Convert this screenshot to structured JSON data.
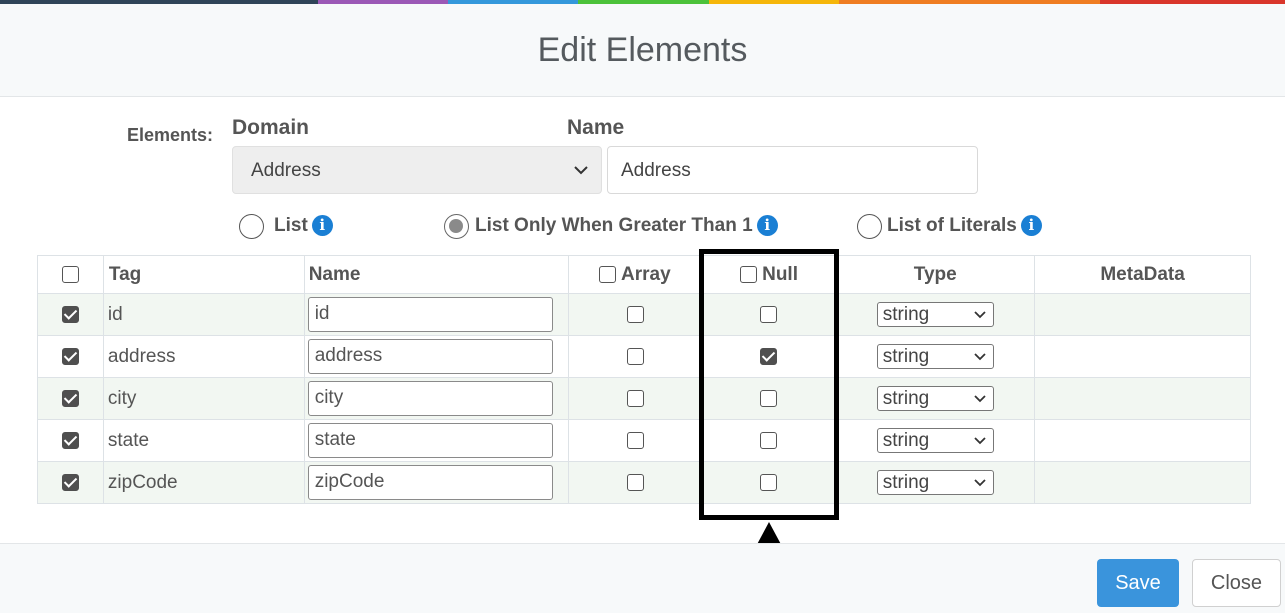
{
  "accent_colors": [
    "#2f4458",
    "#9b59b6",
    "#3498db",
    "#4cc23a",
    "#f5b60a",
    "#ef7d22",
    "#d9362b"
  ],
  "dialog": {
    "title": "Edit Elements"
  },
  "form": {
    "elements_label": "Elements:",
    "domain_label": "Domain",
    "domain_value": "Address",
    "name_label": "Name",
    "name_value": "Address"
  },
  "list_options": [
    {
      "label": "List",
      "selected": false,
      "icon": "info-icon"
    },
    {
      "label": "List Only When Greater Than 1",
      "selected": true,
      "icon": "info-icon"
    },
    {
      "label": "List of Literals",
      "selected": false,
      "icon": "info-icon"
    }
  ],
  "table": {
    "headers": {
      "tag": "Tag",
      "name": "Name",
      "array": "Array",
      "null": "Null",
      "type": "Type",
      "metadata": "MetaData"
    },
    "header_checks": {
      "select_all": false,
      "array": false,
      "null": false
    },
    "rows": [
      {
        "selected": true,
        "tag": "id",
        "name": "id",
        "array": false,
        "null": false,
        "type": "string",
        "metadata": ""
      },
      {
        "selected": true,
        "tag": "address",
        "name": "address",
        "array": false,
        "null": true,
        "type": "string",
        "metadata": ""
      },
      {
        "selected": true,
        "tag": "city",
        "name": "city",
        "array": false,
        "null": false,
        "type": "string",
        "metadata": ""
      },
      {
        "selected": true,
        "tag": "state",
        "name": "state",
        "array": false,
        "null": false,
        "type": "string",
        "metadata": ""
      },
      {
        "selected": true,
        "tag": "zipCode",
        "name": "zipCode",
        "array": false,
        "null": false,
        "type": "string",
        "metadata": ""
      }
    ]
  },
  "footer": {
    "save_label": "Save",
    "close_label": "Close",
    "save_color": "#3a94dc"
  }
}
